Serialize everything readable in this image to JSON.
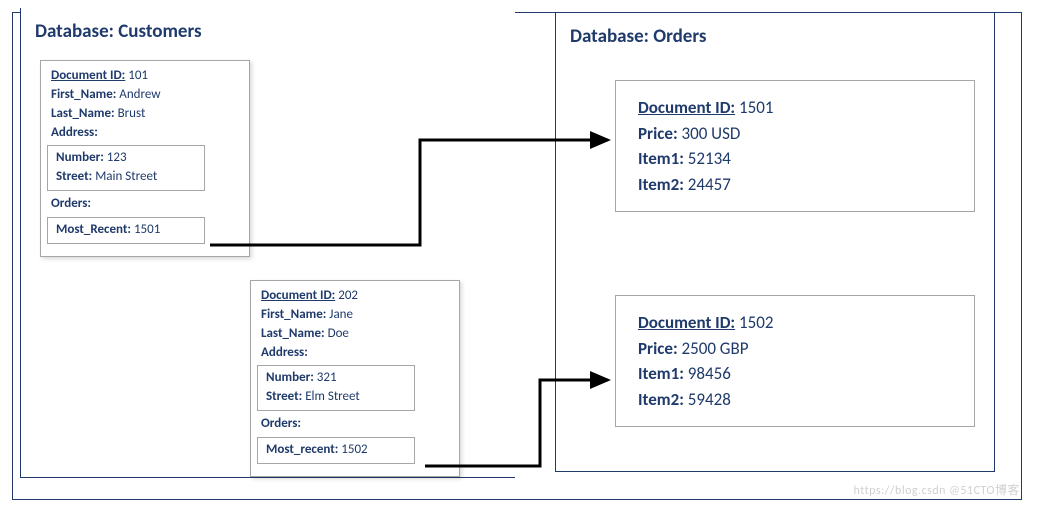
{
  "customers_db": {
    "title": "Database: Customers",
    "docs": [
      {
        "doc_id_label": "Document ID:",
        "doc_id": "101",
        "first_name_label": "First_Name:",
        "first_name": "Andrew",
        "last_name_label": "Last_Name:",
        "last_name": "Brust",
        "address_label": "Address:",
        "address": {
          "number_label": "Number:",
          "number": "123",
          "street_label": "Street:",
          "street": "Main Street"
        },
        "orders_label": "Orders:",
        "orders": {
          "most_recent_label": "Most_Recent:",
          "most_recent": "1501"
        }
      },
      {
        "doc_id_label": "Document ID:",
        "doc_id": "202",
        "first_name_label": "First_Name:",
        "first_name": "Jane",
        "last_name_label": "Last_Name:",
        "last_name": "Doe",
        "address_label": "Address:",
        "address": {
          "number_label": "Number:",
          "number": "321",
          "street_label": "Street:",
          "street": "Elm Street"
        },
        "orders_label": "Orders:",
        "orders": {
          "most_recent_label": "Most_recent:",
          "most_recent": "1502"
        }
      }
    ]
  },
  "orders_db": {
    "title": "Database: Orders",
    "docs": [
      {
        "doc_id_label": "Document ID:",
        "doc_id": "1501",
        "price_label": "Price:",
        "price": "300 USD",
        "item1_label": "Item1:",
        "item1": "52134",
        "item2_label": "Item2:",
        "item2": "24457"
      },
      {
        "doc_id_label": "Document ID:",
        "doc_id": "1502",
        "price_label": "Price:",
        "price": "2500 GBP",
        "item1_label": "Item1:",
        "item1": "98456",
        "item2_label": "Item2:",
        "item2": "59428"
      }
    ]
  },
  "watermark": "https://blog.csdn @51CTO博客"
}
